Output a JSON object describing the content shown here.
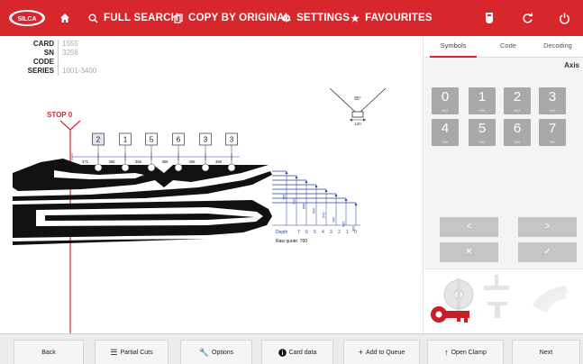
{
  "topbar": {
    "nav": [
      {
        "icon": "home-icon",
        "label": ""
      },
      {
        "icon": "search-icon",
        "label": "FULL SEARCH"
      },
      {
        "icon": "copy-icon",
        "label": "COPY BY ORIGINAL"
      },
      {
        "icon": "gear-icon",
        "label": "SETTINGS"
      },
      {
        "icon": "star-icon",
        "label": "FAVOURITES"
      }
    ],
    "right_icons": [
      "key-fob-icon",
      "refresh-icon",
      "power-icon"
    ]
  },
  "card_info": {
    "rows": [
      {
        "label": "CARD",
        "value": "1555"
      },
      {
        "label": "SN",
        "value": "3256"
      },
      {
        "label": "CODE",
        "value": ""
      },
      {
        "label": "SERIES",
        "value": "1001-3400"
      }
    ]
  },
  "drawing": {
    "stop_label": "STOP 0",
    "angle_label": "85°",
    "angle_width_label": "130",
    "cuts": [
      "2",
      "1",
      "5",
      "6",
      "3",
      "3"
    ],
    "spacings": [
      "371",
      "356",
      "356",
      "356",
      "356",
      "356"
    ],
    "depth_label": "Depth",
    "depth_numbers": [
      "7",
      "6",
      "5",
      "4",
      "3",
      "2",
      "1",
      "0"
    ],
    "depth_values": [
      "380",
      "435",
      "490",
      "545",
      "600",
      "655",
      "710",
      "765"
    ],
    "raw_quote": "Raw quote: 700"
  },
  "right_panel": {
    "tabs": [
      {
        "label": "Symbols",
        "active": true
      },
      {
        "label": "Code",
        "active": false
      },
      {
        "label": "Decoding",
        "active": false
      }
    ],
    "axis_label": "Axis",
    "digits": [
      {
        "n": "0",
        "sub": "680"
      },
      {
        "n": "1",
        "sub": "635"
      },
      {
        "n": "2",
        "sub": "589"
      },
      {
        "n": "3",
        "sub": "543"
      },
      {
        "n": "4",
        "sub": "498"
      },
      {
        "n": "5",
        "sub": "452"
      },
      {
        "n": "6",
        "sub": "406"
      },
      {
        "n": "7",
        "sub": "360"
      }
    ],
    "controls": {
      "prev": "<",
      "next": ">",
      "cancel": "✕",
      "confirm": "✓"
    }
  },
  "bottombar": {
    "buttons": [
      {
        "name": "back-button",
        "icon": "",
        "label": "Back"
      },
      {
        "name": "partial-cuts-button",
        "icon": "list-icon",
        "label": "Partial Cuts"
      },
      {
        "name": "options-button",
        "icon": "wrench-icon",
        "label": "Options"
      },
      {
        "name": "card-data-button",
        "icon": "info-icon",
        "label": "Card data"
      },
      {
        "name": "add-to-queue-button",
        "icon": "plus-icon",
        "label": "Add to Queue"
      },
      {
        "name": "open-clamp-button",
        "icon": "arrow-up-icon",
        "label": "Open Clamp"
      },
      {
        "name": "next-button",
        "icon": "",
        "label": "Next"
      }
    ]
  },
  "colors": {
    "brand_red": "#d8262d",
    "digit_grey": "#a9a9a9",
    "control_grey": "#c5c5c5",
    "dimension_blue": "#2a3f9c"
  }
}
